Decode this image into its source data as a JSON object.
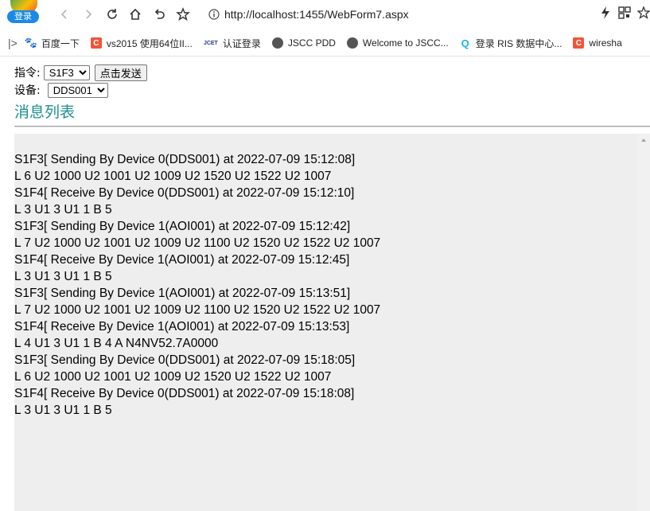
{
  "browser": {
    "login_badge": "登录",
    "url": "http://localhost:1455/WebForm7.aspx"
  },
  "bookmarks": [
    {
      "label": "百度一下",
      "icon": "paw-icon",
      "color": "#2932e1"
    },
    {
      "label": "vs2015 使用64位II...",
      "icon": "c-icon",
      "color": "#f1543a"
    },
    {
      "label": "认证登录",
      "icon": "jcet-icon",
      "color": "#2a3a8c"
    },
    {
      "label": "JSCC PDD",
      "icon": "globe-icon",
      "color": "#555555"
    },
    {
      "label": "Welcome to JSCC...",
      "icon": "globe-icon",
      "color": "#555555"
    },
    {
      "label": "登录 RIS 数据中心...",
      "icon": "q-icon",
      "color": "#1ab3e8"
    },
    {
      "label": "wiresha",
      "icon": "c-icon",
      "color": "#f1543a"
    }
  ],
  "form": {
    "command_label": "指令:",
    "command_value": "S1F3",
    "send_label": "点击发送",
    "device_label": "设备:",
    "device_value": "DDS001"
  },
  "heading": "消息列表",
  "messages": [
    "S1F3[ Sending By Device 0(DDS001) at 2022-07-09 15:12:08]",
    "L 6 U2 1000 U2 1001 U2 1009 U2 1520 U2 1522 U2 1007",
    "S1F4[ Receive By Device 0(DDS001) at 2022-07-09 15:12:10]",
    "L 3 U1 3 U1 1 B 5",
    "S1F3[ Sending By Device 1(AOI001) at 2022-07-09 15:12:42]",
    "L 7 U2 1000 U2 1001 U2 1009 U2 1100 U2 1520 U2 1522 U2 1007",
    "S1F4[ Receive By Device 1(AOI001) at 2022-07-09 15:12:45]",
    "L 3 U1 3 U1 1 B 5",
    "S1F3[ Sending By Device 1(AOI001) at 2022-07-09 15:13:51]",
    "L 7 U2 1000 U2 1001 U2 1009 U2 1100 U2 1520 U2 1522 U2 1007",
    "S1F4[ Receive By Device 1(AOI001) at 2022-07-09 15:13:53]",
    "L 4 U1 3 U1 1 B 4 A N4NV52.7A0000",
    "S1F3[ Sending By Device 0(DDS001) at 2022-07-09 15:18:05]",
    "L 6 U2 1000 U2 1001 U2 1009 U2 1520 U2 1522 U2 1007",
    "S1F4[ Receive By Device 0(DDS001) at 2022-07-09 15:18:08]",
    "L 3 U1 3 U1 1 B 5"
  ]
}
